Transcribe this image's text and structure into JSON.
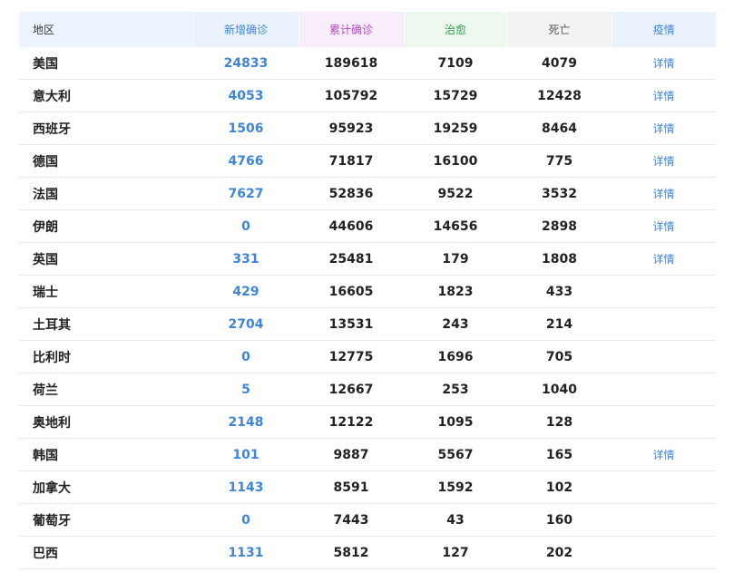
{
  "header": {
    "region": "地区",
    "new_confirmed": "新增确诊",
    "total_confirmed": "累计确诊",
    "cured": "治愈",
    "deaths": "死亡",
    "epidemic": "疫情"
  },
  "colors": {
    "new": "#3f86d8",
    "total": "#b04ac1",
    "cured": "#2e9e48",
    "deaths": "#555555"
  },
  "rows": [
    {
      "region": "美国",
      "new": "24833",
      "total": "189618",
      "cured": "7109",
      "deaths": "4079",
      "detail": "详情"
    },
    {
      "region": "意大利",
      "new": "4053",
      "total": "105792",
      "cured": "15729",
      "deaths": "12428",
      "detail": "详情"
    },
    {
      "region": "西班牙",
      "new": "1506",
      "total": "95923",
      "cured": "19259",
      "deaths": "8464",
      "detail": "详情"
    },
    {
      "region": "德国",
      "new": "4766",
      "total": "71817",
      "cured": "16100",
      "deaths": "775",
      "detail": "详情"
    },
    {
      "region": "法国",
      "new": "7627",
      "total": "52836",
      "cured": "9522",
      "deaths": "3532",
      "detail": "详情"
    },
    {
      "region": "伊朗",
      "new": "0",
      "total": "44606",
      "cured": "14656",
      "deaths": "2898",
      "detail": "详情"
    },
    {
      "region": "英国",
      "new": "331",
      "total": "25481",
      "cured": "179",
      "deaths": "1808",
      "detail": "详情"
    },
    {
      "region": "瑞士",
      "new": "429",
      "total": "16605",
      "cured": "1823",
      "deaths": "433",
      "detail": ""
    },
    {
      "region": "土耳其",
      "new": "2704",
      "total": "13531",
      "cured": "243",
      "deaths": "214",
      "detail": ""
    },
    {
      "region": "比利时",
      "new": "0",
      "total": "12775",
      "cured": "1696",
      "deaths": "705",
      "detail": ""
    },
    {
      "region": "荷兰",
      "new": "5",
      "total": "12667",
      "cured": "253",
      "deaths": "1040",
      "detail": ""
    },
    {
      "region": "奥地利",
      "new": "2148",
      "total": "12122",
      "cured": "1095",
      "deaths": "128",
      "detail": ""
    },
    {
      "region": "韩国",
      "new": "101",
      "total": "9887",
      "cured": "5567",
      "deaths": "165",
      "detail": "详情"
    },
    {
      "region": "加拿大",
      "new": "1143",
      "total": "8591",
      "cured": "1592",
      "deaths": "102",
      "detail": ""
    },
    {
      "region": "葡萄牙",
      "new": "0",
      "total": "7443",
      "cured": "43",
      "deaths": "160",
      "detail": ""
    },
    {
      "region": "巴西",
      "new": "1131",
      "total": "5812",
      "cured": "127",
      "deaths": "202",
      "detail": ""
    }
  ]
}
